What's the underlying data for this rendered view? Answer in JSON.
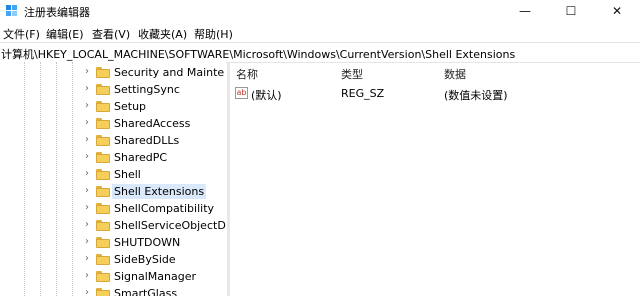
{
  "window": {
    "title": "注册表编辑器",
    "minimize": "—",
    "maximize": "☐",
    "close": "✕"
  },
  "menu": [
    "文件(F)",
    "编辑(E)",
    "查看(V)",
    "收藏夹(A)",
    "帮助(H)"
  ],
  "address": "计算机\\HKEY_LOCAL_MACHINE\\SOFTWARE\\Microsoft\\Windows\\CurrentVersion\\Shell Extensions",
  "tree": {
    "chevron": "›",
    "items": [
      "Security and Mainte",
      "SettingSync",
      "Setup",
      "SharedAccess",
      "SharedDLLs",
      "SharedPC",
      "Shell",
      "Shell Extensions",
      "ShellCompatibility",
      "ShellServiceObjectD",
      "SHUTDOWN",
      "SideBySide",
      "SignalManager",
      "SmartGlass"
    ],
    "selected_index": 7
  },
  "list": {
    "headers": {
      "name": "名称",
      "type": "类型",
      "data": "数据"
    },
    "rows": [
      {
        "icon": "ab",
        "name": "(默认)",
        "type": "REG_SZ",
        "data": "(数值未设置)"
      }
    ]
  }
}
